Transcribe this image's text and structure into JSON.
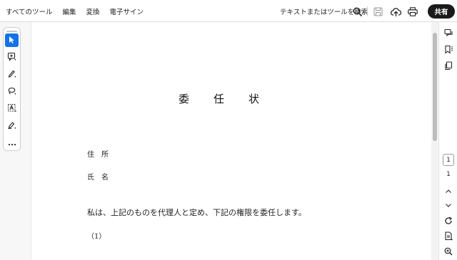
{
  "topbar": {
    "menu": [
      {
        "label": "すべてのツール"
      },
      {
        "label": "編集"
      },
      {
        "label": "変換"
      },
      {
        "label": "電子サイン"
      }
    ],
    "search_label": "テキストまたはツールを検索",
    "share_label": "共有"
  },
  "tools": [
    {
      "icon": "cursor-arrow-icon",
      "active": true
    },
    {
      "icon": "add-comment-icon",
      "active": false
    },
    {
      "icon": "highlight-pen-icon",
      "active": false
    },
    {
      "icon": "lasso-draw-icon",
      "active": false
    },
    {
      "icon": "text-select-icon",
      "active": false
    },
    {
      "icon": "fill-sign-icon",
      "active": false
    },
    {
      "icon": "more-options-icon",
      "active": false
    }
  ],
  "document": {
    "title": "委任状",
    "address_label": "住　所",
    "name_label": "氏　名",
    "body_sentence": "私は、上記のものを代理人と定め、下記の権限を委任します。",
    "item_number": "（1）"
  },
  "navigation": {
    "current_page": "1",
    "total_pages": "1"
  },
  "colors": {
    "accent": "#1473e6",
    "share_button": "#1a1a1a"
  }
}
